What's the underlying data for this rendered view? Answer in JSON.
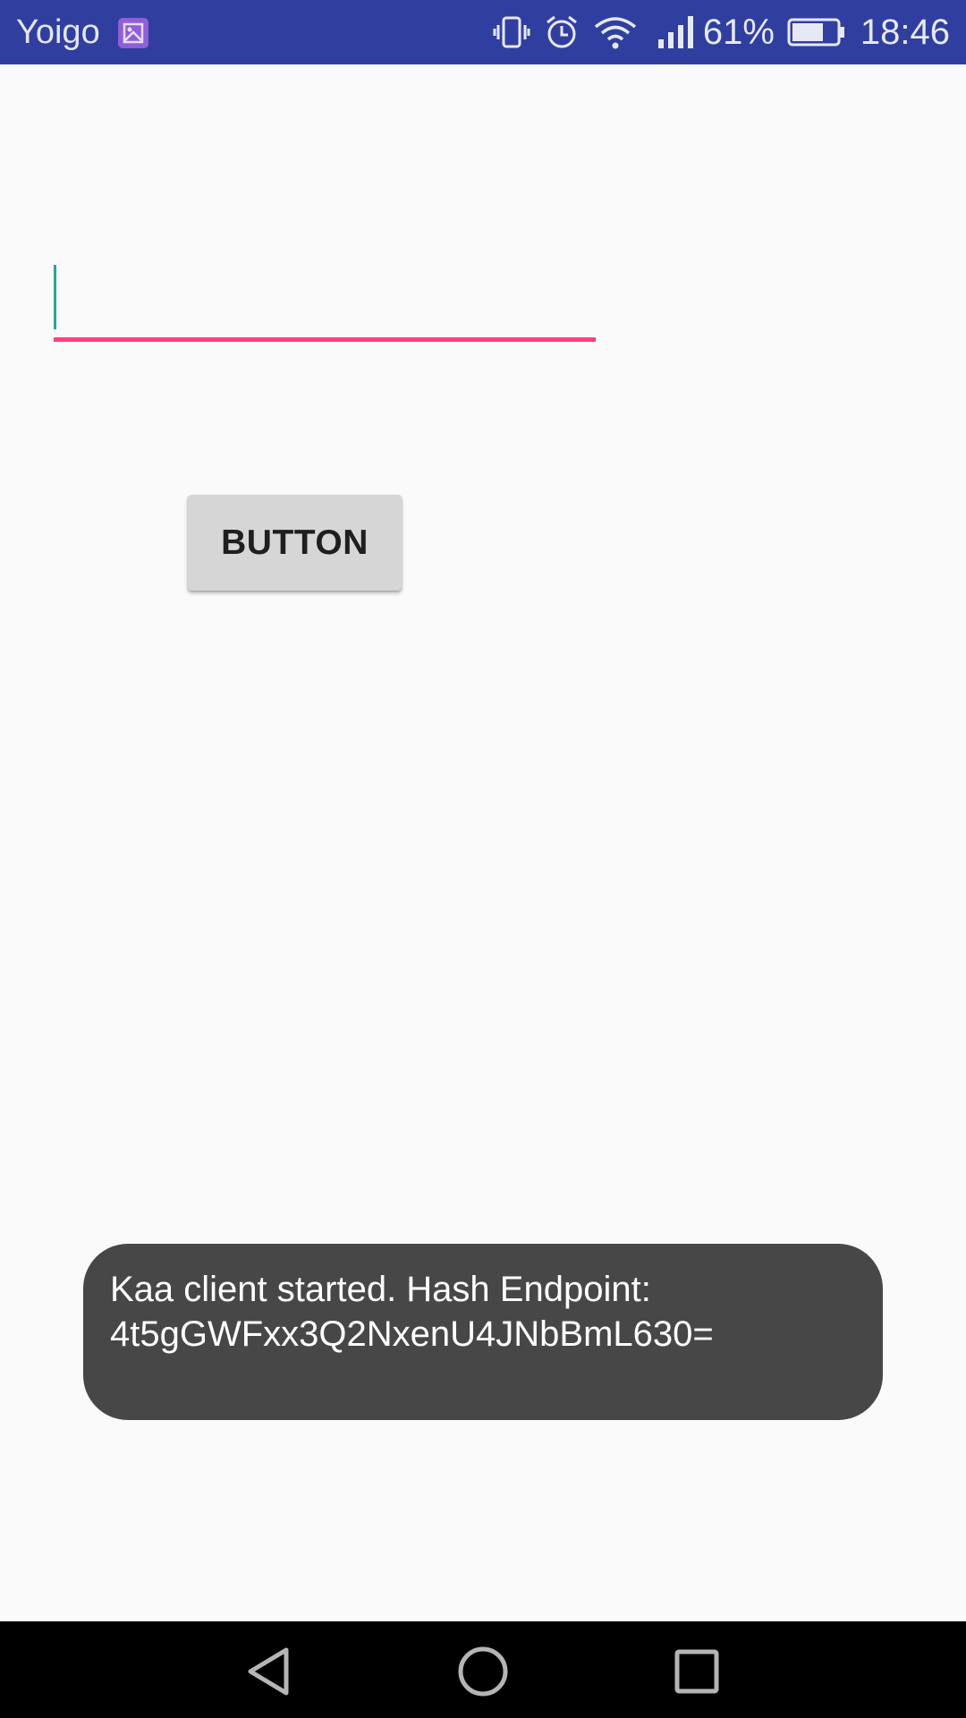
{
  "status_bar": {
    "carrier": "Yoigo",
    "battery_percent": "61%",
    "time": "18:46",
    "icons": [
      "gallery-notification-icon",
      "vibrate-icon",
      "alarm-icon",
      "wifi-icon",
      "signal-icon",
      "battery-icon"
    ],
    "background_color": "#303f9f"
  },
  "edit_text": {
    "value": "",
    "accent_color": "#ff4081",
    "cursor_color": "#26a69a"
  },
  "button": {
    "label": "BUTTON"
  },
  "toast": {
    "line1": "Kaa client started. Hash Endpoint:",
    "line2": "4t5gGWFxx3Q2NxenU4JNbBmL630="
  },
  "nav_bar": {
    "icons": [
      "back-icon",
      "home-icon",
      "recents-icon"
    ]
  }
}
